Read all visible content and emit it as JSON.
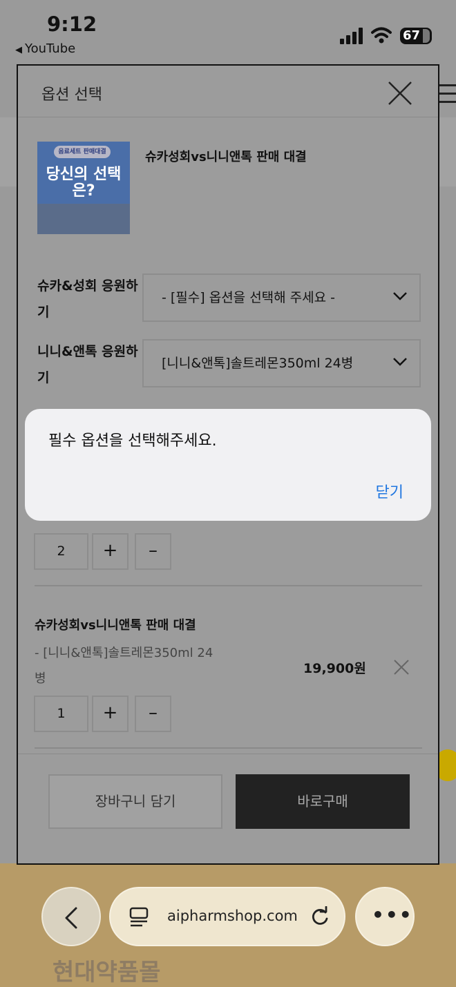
{
  "status_bar": {
    "time": "9:12",
    "back_app": "YouTube",
    "battery": "67"
  },
  "sheet": {
    "title": "옵션 선택",
    "product": {
      "name": "슈카성회vs니니앤톡 판매 대결",
      "thumb_top": "음료세트 판매대결",
      "thumb_big": "당신의 선택은?"
    },
    "options": [
      {
        "label": "슈카&성회 응원하기",
        "value": "- [필수] 옵션을 선택해 주세요 -"
      },
      {
        "label": "니니&앤톡 응원하기",
        "value": "[니니&앤톡]솔트레몬350ml 24병"
      }
    ],
    "items": [
      {
        "quantity": "2"
      },
      {
        "name": "슈카성회vs니니앤톡 판매 대결",
        "option": "- [니니&앤톡]솔트레몬350ml 24병",
        "price": "19,900원",
        "quantity": "1"
      }
    ],
    "plus_label": "+",
    "minus_label": "–",
    "cart_button": "장바구니 담기",
    "buy_button": "바로구매"
  },
  "alert": {
    "message": "필수 옵션을 선택해주세요.",
    "close_label": "닫기"
  },
  "browser": {
    "url": "aipharmshop.com",
    "more": "•••"
  },
  "background": {
    "logo_text": "현대약품몰"
  },
  "colors": {
    "alert_link": "#1f76e0",
    "buy_button_bg": "#222222",
    "overlay": "#9c9c9c"
  }
}
